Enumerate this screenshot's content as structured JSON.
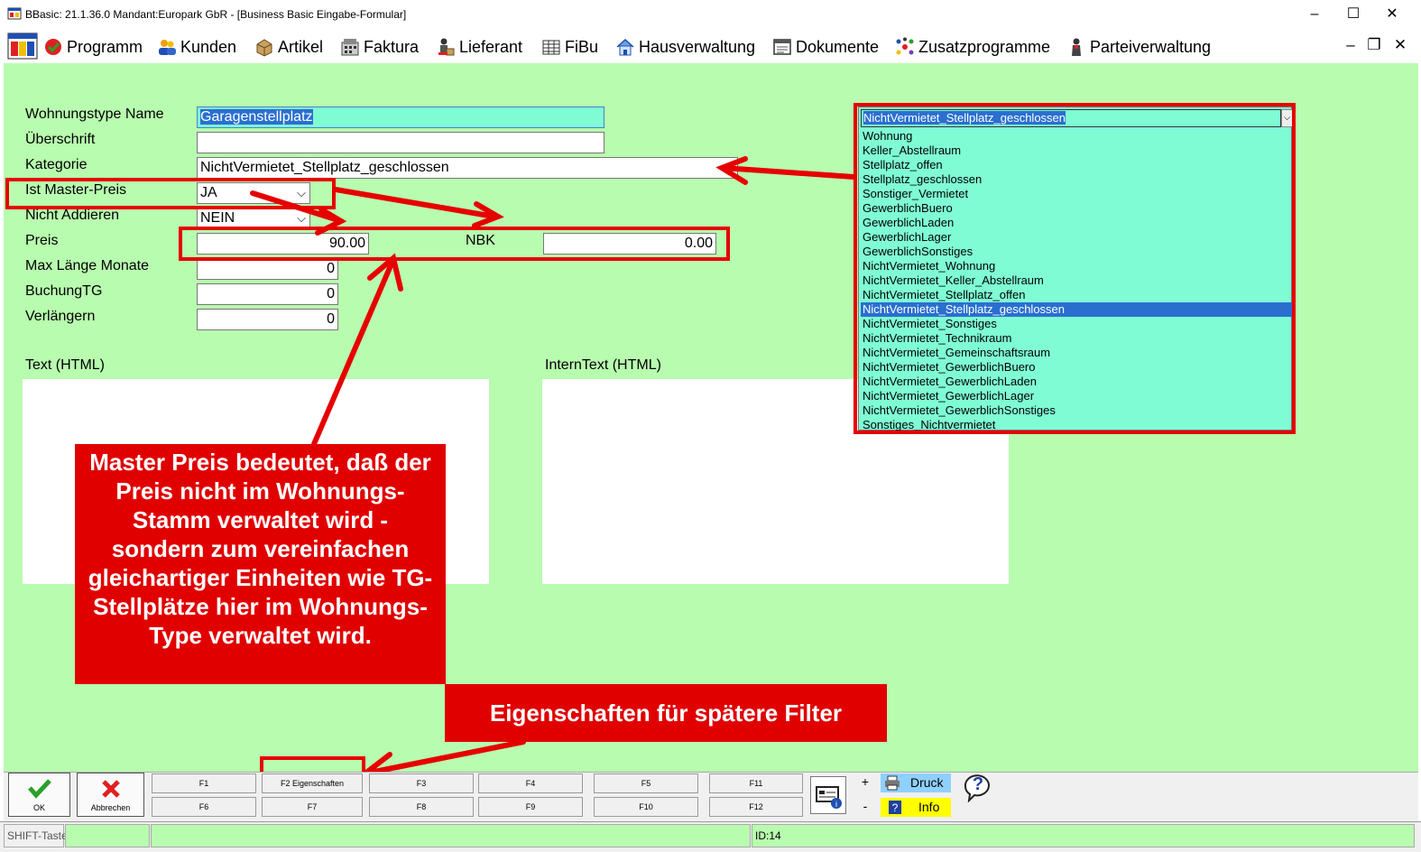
{
  "window": {
    "title": "BBasic: 21.1.36.0 Mandant:Europark GbR  - [Business Basic Eingabe-Formular]",
    "minimize": "–",
    "maximize": "☐",
    "close": "✕"
  },
  "menu": {
    "items": [
      "Programm",
      "Kunden",
      "Artikel",
      "Faktura",
      "Lieferant",
      "FiBu",
      "Hausverwaltung",
      "Dokumente",
      "Zusatzprogramme",
      "Parteiverwaltung"
    ],
    "mdi_min": "–",
    "mdi_restore": "❐",
    "mdi_close": "✕"
  },
  "form": {
    "labels": {
      "wohnungstype_name": "Wohnungstype Name",
      "ueberschrift": "Überschrift",
      "kategorie": "Kategorie",
      "ist_master_preis": "Ist Master-Preis",
      "nicht_addieren": "Nicht Addieren",
      "preis": "Preis",
      "nbk": "NBK",
      "max_laenge_monate": "Max Länge Monate",
      "buchung_tg": "BuchungTG",
      "verlaengern": "Verlängern",
      "text_html": "Text (HTML)",
      "interntext_html": "InternText (HTML)"
    },
    "values": {
      "wohnungstype_name": "Garagenstellplatz",
      "ueberschrift": "",
      "kategorie": "NichtVermietet_Stellplatz_geschlossen",
      "ist_master_preis": "JA",
      "nicht_addieren": "NEIN",
      "preis": "90.00",
      "nbk": "0.00",
      "max_laenge_monate": "0",
      "buchung_tg": "0",
      "verlaengern": "0"
    }
  },
  "dropdown": {
    "selected": "NichtVermietet_Stellplatz_geschlossen",
    "options": [
      "Wohnung",
      "Keller_Abstellraum",
      "Stellplatz_offen",
      "Stellplatz_geschlossen",
      "Sonstiger_Vermietet",
      "GewerblichBuero",
      "GewerblichLaden",
      "GewerblichLager",
      "GewerblichSonstiges",
      "NichtVermietet_Wohnung",
      "NichtVermietet_Keller_Abstellraum",
      "NichtVermietet_Stellplatz_offen",
      "NichtVermietet_Stellplatz_geschlossen",
      "NichtVermietet_Sonstiges",
      "NichtVermietet_Technikraum",
      "NichtVermietet_Gemeinschaftsraum",
      "NichtVermietet_GewerblichBuero",
      "NichtVermietet_GewerblichLaden",
      "NichtVermietet_GewerblichLager",
      "NichtVermietet_GewerblichSonstiges",
      "Sonstiges_Nichtvermietet"
    ],
    "selected_index": 12
  },
  "annotations": {
    "master_preis": "Master Preis bedeutet, daß der Preis nicht im Wohnungs-Stamm verwaltet wird - sondern zum vereinfachen gleichartiger Einheiten wie TG-Stellplätze hier im Wohnungs-Type verwaltet wird.",
    "eigenschaften": "Eigenschaften für spätere Filter"
  },
  "toolbar": {
    "ok": "OK",
    "abbrechen": "Abbrechen",
    "fkeys_top": [
      "F1",
      "F2 Eigenschaften",
      "F3",
      "F4",
      "F5",
      "F11"
    ],
    "fkeys_bottom": [
      "F6",
      "F7",
      "F8",
      "F9",
      "F10",
      "F12"
    ],
    "plus": "+",
    "minus": "-",
    "druck": "Druck",
    "info": "Info",
    "help": "?"
  },
  "status": {
    "shift": "SHIFT-Taste",
    "id": "ID:14"
  },
  "colors": {
    "form_bg": "#b8fcaf",
    "annotation_red": "#e00000",
    "highlight": "#2a6fd0",
    "list_bg": "#7ffcd4"
  }
}
